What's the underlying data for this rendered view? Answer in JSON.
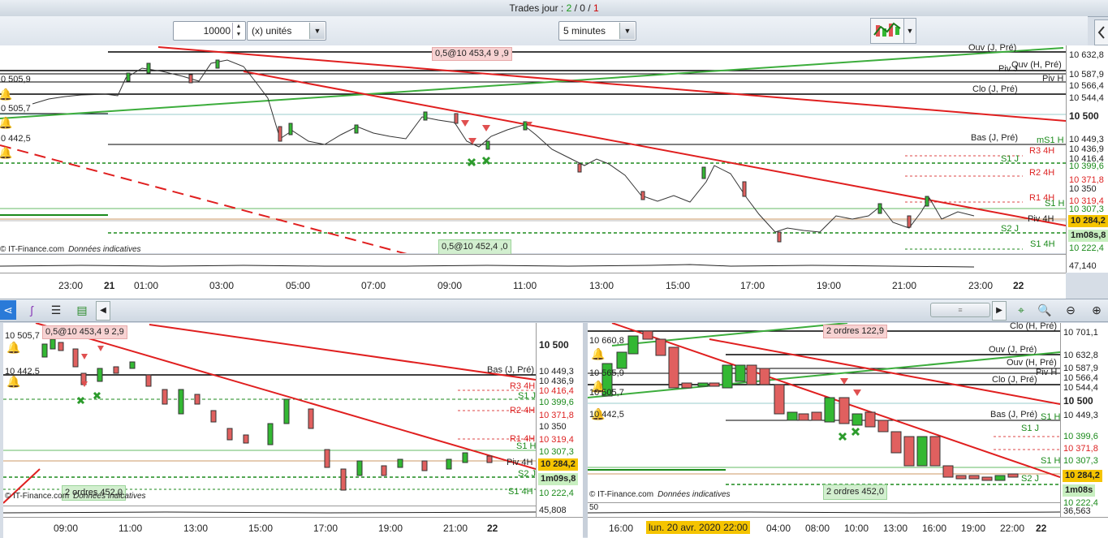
{
  "header": {
    "title_prefix": "Trades jour : ",
    "t1": "2",
    "sep1": " / ",
    "t2": "0",
    "sep2": " / ",
    "t3": "1"
  },
  "toolbar": {
    "quantity": "10000",
    "unit_label": "(x) unités",
    "interval": "5 minutes"
  },
  "top_chart": {
    "scale": [
      "10 632,8",
      "10 587,9",
      "10 566,4",
      "10 544,4",
      "10 500",
      "10 449,3",
      "10 436,9",
      "10 416,4",
      "10 399,6",
      "10 371,8",
      "10 350",
      "10 319,4",
      "10 307,3",
      "10 284,2",
      "1m08s,8",
      "10 222,4",
      "47,140"
    ],
    "levels": [
      "Ouv (J, Pré)",
      "Quv (H, Pré)",
      "Piv H",
      "Piv J",
      "Clo (J, Pré)",
      "Bas (J, Pré)",
      "mS1 H",
      "R3 4H",
      "S1 J",
      "R2 4H",
      "R1 4H",
      "S1 H",
      "Piv 4H",
      "S2 J",
      "S1 4H"
    ],
    "left_prices": [
      "0 505,9",
      "0 505,7",
      "0 442,5"
    ],
    "orders": {
      "top": "0,5@10 453,4  9  ,9",
      "bottom": "0,5@10 452,4  ,0"
    },
    "times": [
      "23:00",
      "21",
      "01:00",
      "03:00",
      "05:00",
      "07:00",
      "09:00",
      "11:00",
      "13:00",
      "15:00",
      "17:00",
      "19:00",
      "21:00",
      "23:00",
      "22"
    ],
    "credit": "© IT-Finance.com",
    "credit_note": "Données indicatives"
  },
  "bottom_left": {
    "scale": [
      "10 500",
      "10 449,3",
      "10 436,9",
      "10 416,4",
      "10 399,6",
      "10 371,8",
      "10 350",
      "10 319,4",
      "10 307,3",
      "10 284,2",
      "1m09s,8",
      "10 222,4",
      "45,808"
    ],
    "levels": [
      "Bas (J, Pré)",
      "R3 4H",
      "S1 J",
      "R2 4H",
      "R1 4H",
      "S1 H",
      "Piv 4H",
      "S2 J",
      "S1 4H"
    ],
    "left_prices": [
      "10 505,7",
      "10 442,5"
    ],
    "orders": {
      "top": "0,5@10 453,4 9 2,9",
      "bottom": "2 ordres 452,0"
    },
    "times": [
      "09:00",
      "11:00",
      "13:00",
      "15:00",
      "17:00",
      "19:00",
      "21:00",
      "22"
    ],
    "credit": "© IT-Finance.com",
    "credit_note": "Données indicatives"
  },
  "bottom_right": {
    "scale": [
      "10 701,1",
      "10 632,8",
      "10 587,9",
      "10 566,4",
      "10 544,4",
      "10 500",
      "10 449,3",
      "10 399,6",
      "10 371,8",
      "10 307,3",
      "10 284,2",
      "1m08s",
      "10 222,4",
      "36,563"
    ],
    "levels": [
      "Clo (H, Pré)",
      "Ouv (J, Pré)",
      "Ouv (H, Pré)",
      "Piv H",
      "Clo (J, Pré)",
      "Bas (J, Pré)",
      "S1 H",
      "S1 J",
      "S1 H",
      "S2 J"
    ],
    "left_prices": [
      "10 660,8",
      "10 565,9",
      "10 505,7",
      "10 442,5"
    ],
    "orders": {
      "top": "2 ordres 122,9",
      "bottom": "2 ordres 452,0"
    },
    "osc_label": "50",
    "times": [
      "16:00",
      "04:00",
      "08:00",
      "10:00",
      "13:00",
      "16:00",
      "19:00",
      "22:00",
      "22"
    ],
    "date_tag": "lun. 20 avr. 2020 22:00",
    "credit": "© IT-Finance.com",
    "credit_note": "Données indicatives"
  },
  "colors": {
    "up": "#33b833",
    "down": "#e0605f",
    "trend": "#e01f1f",
    "support": "#1b8a1b",
    "price_tag": "#f5c400"
  }
}
